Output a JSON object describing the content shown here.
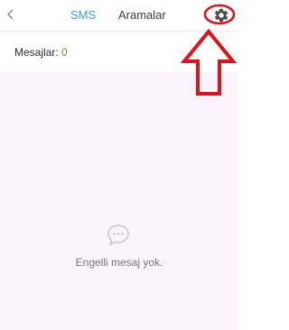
{
  "header": {
    "back_icon": "chevron-left-icon",
    "tabs": [
      {
        "label": "SMS",
        "active": true
      },
      {
        "label": "Aramalar",
        "active": false
      }
    ],
    "settings_icon": "gear-icon"
  },
  "messages": {
    "label": "Mesajlar:",
    "count": "0"
  },
  "empty_state": {
    "icon": "chat-bubble-icon",
    "text": "Engelli mesaj yok."
  },
  "colors": {
    "active_tab": "#3a9ee8",
    "count": "#5aa12a",
    "annotation": "#e0121c",
    "content_background": "#fbf5fb"
  }
}
